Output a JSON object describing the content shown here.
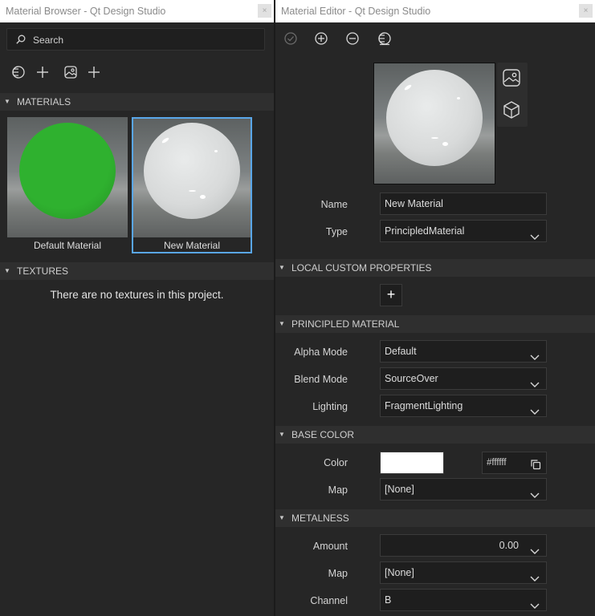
{
  "browser": {
    "title": "Material Browser - Qt Design Studio",
    "close_label": "×",
    "search_placeholder": "Search",
    "materials_section": "MATERIALS",
    "materials": [
      {
        "name": "Default Material",
        "color": "#2fb12f"
      },
      {
        "name": "New Material",
        "color": "#dcdede"
      }
    ],
    "textures_section": "TEXTURES",
    "textures_empty": "There are no textures in this project."
  },
  "editor": {
    "title": "Material Editor - Qt Design Studio",
    "close_label": "×",
    "name_label": "Name",
    "name_value": "New Material",
    "type_label": "Type",
    "type_value": "PrincipledMaterial",
    "local_custom_section": "LOCAL CUSTOM PROPERTIES",
    "add_property_label": "+",
    "principled_section": "PRINCIPLED MATERIAL",
    "alpha_mode_label": "Alpha Mode",
    "alpha_mode_value": "Default",
    "blend_mode_label": "Blend Mode",
    "blend_mode_value": "SourceOver",
    "lighting_label": "Lighting",
    "lighting_value": "FragmentLighting",
    "base_color_section": "BASE COLOR",
    "color_label": "Color",
    "color_hex": "#ffffff",
    "base_map_label": "Map",
    "base_map_value": "[None]",
    "metalness_section": "METALNESS",
    "amount_label": "Amount",
    "amount_value": "0.00",
    "metal_map_label": "Map",
    "metal_map_value": "[None]",
    "channel_label": "Channel",
    "channel_value": "B"
  },
  "colors": {
    "selection": "#59a6e8",
    "panel": "#262626",
    "section": "#2f2f2f"
  }
}
